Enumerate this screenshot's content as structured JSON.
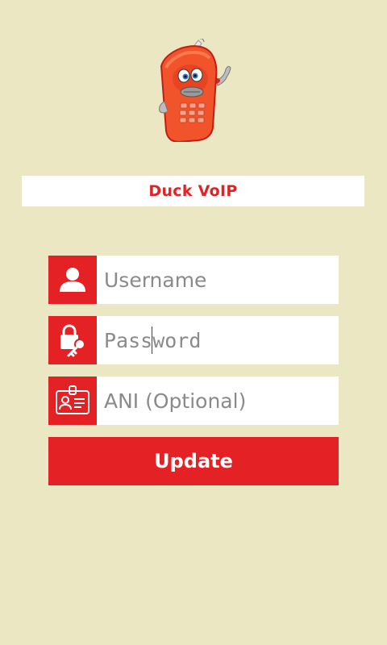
{
  "app": {
    "brand_name": "Duck VoIP",
    "accent_color": "#e42124",
    "background_color": "#ece7c3"
  },
  "form": {
    "username": {
      "placeholder": "Username",
      "value": "",
      "icon": "user-icon"
    },
    "password": {
      "placeholder": "Password",
      "value": "",
      "icon": "lock-key-icon",
      "focused": true
    },
    "ani": {
      "placeholder": "ANI (Optional)",
      "value": "",
      "icon": "id-badge-icon"
    },
    "submit_label": "Update"
  }
}
